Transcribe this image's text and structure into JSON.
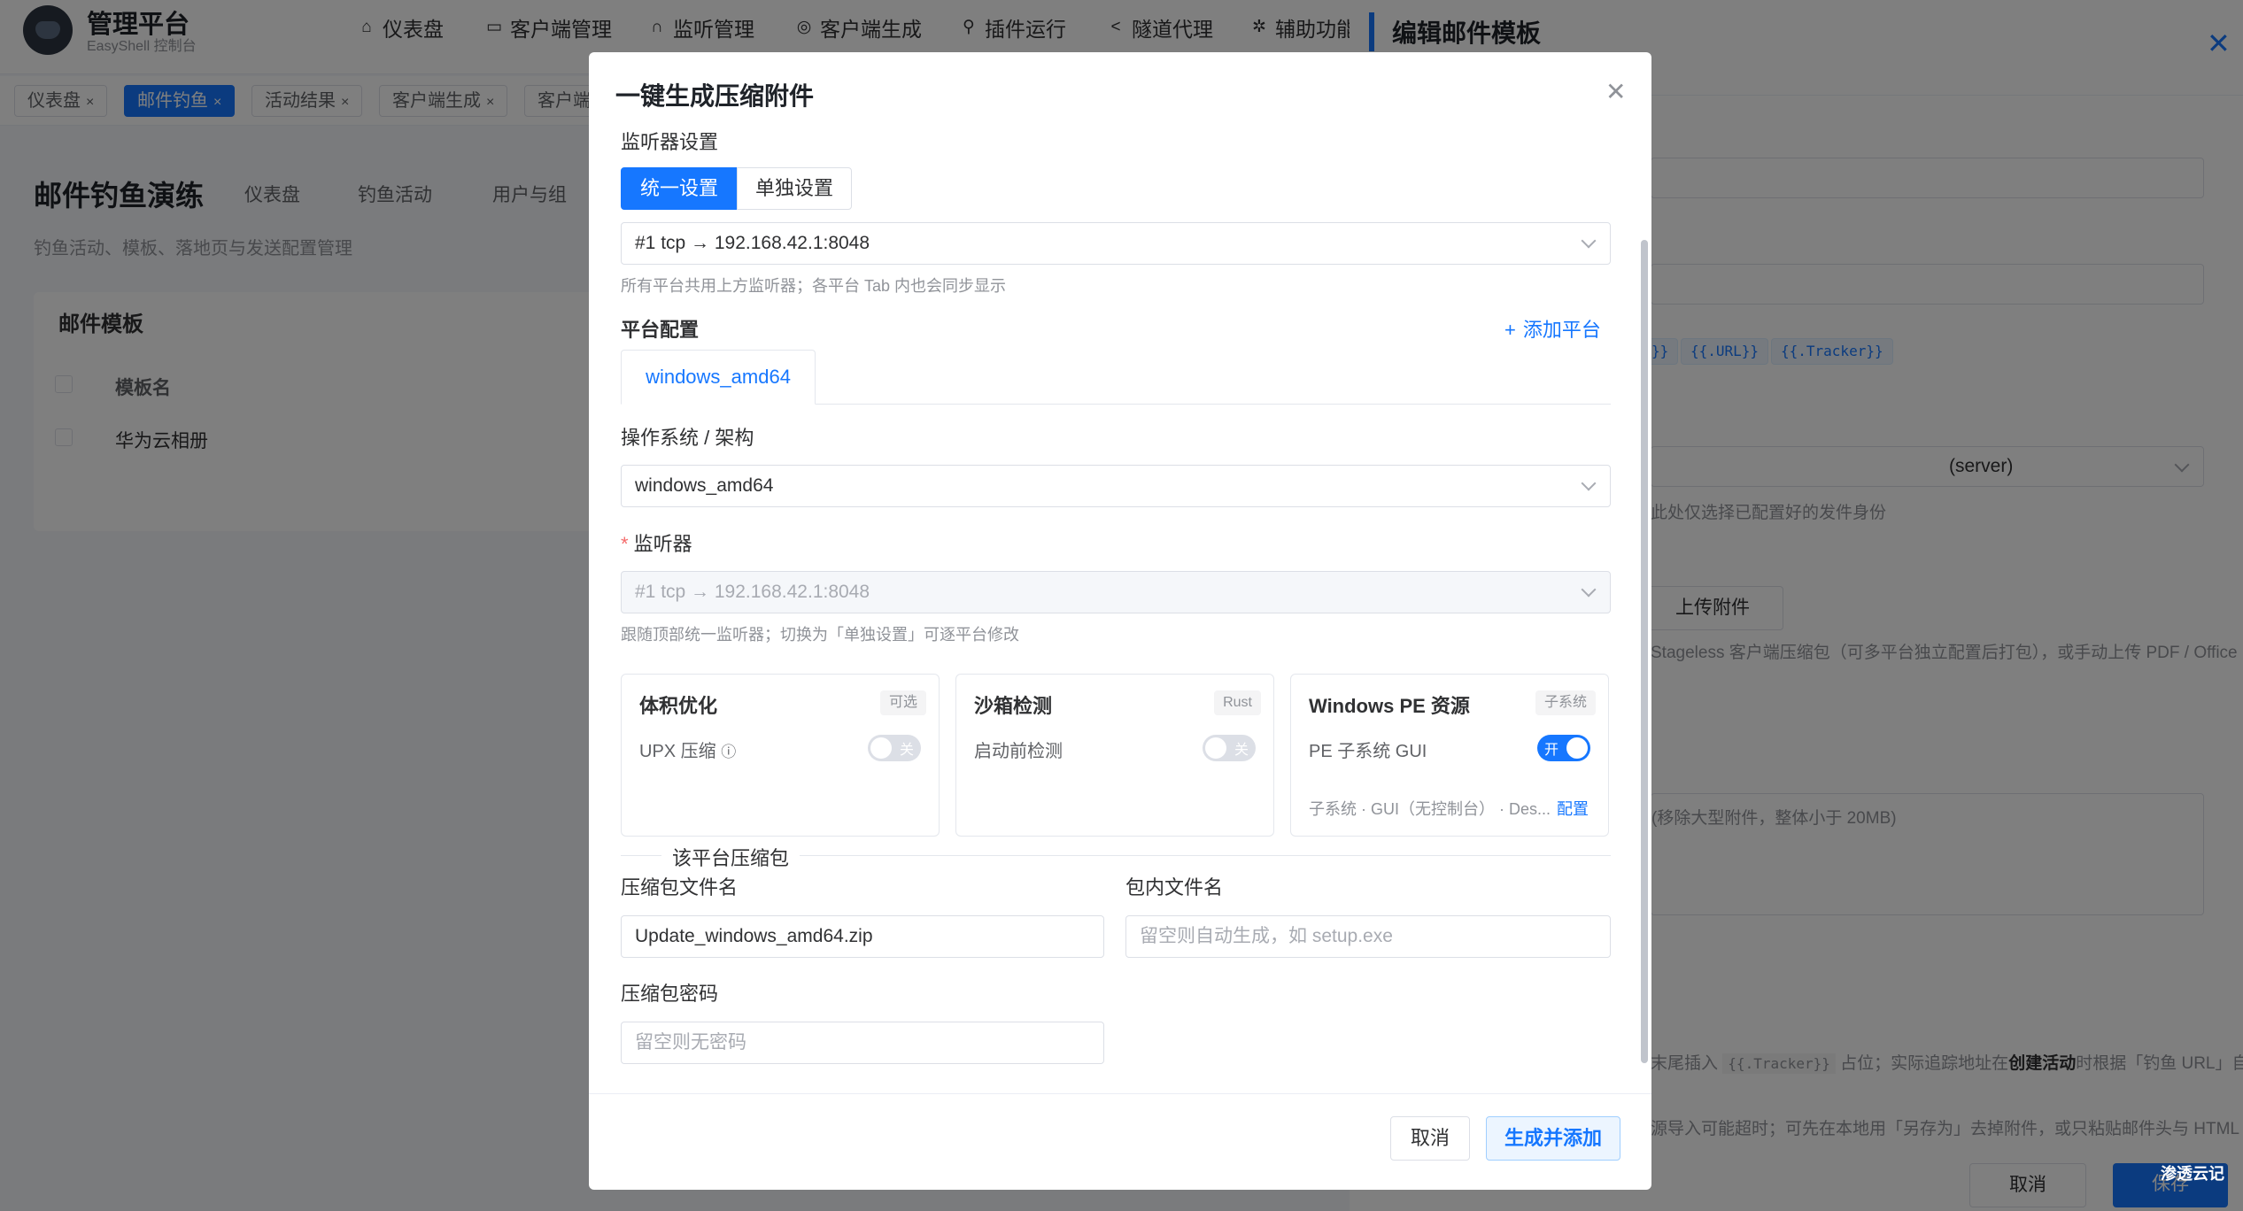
{
  "app": {
    "title": "管理平台",
    "subtitle": "EasyShell 控制台",
    "nav": [
      {
        "label": "仪表盘",
        "icon": "home-icon"
      },
      {
        "label": "客户端管理",
        "icon": "monitor-icon"
      },
      {
        "label": "监听管理",
        "icon": "headset-icon"
      },
      {
        "label": "客户端生成",
        "icon": "package-icon"
      },
      {
        "label": "插件运行",
        "icon": "plugin-icon"
      },
      {
        "label": "隧道代理",
        "icon": "share-icon"
      },
      {
        "label": "辅助功能",
        "icon": "gear-icon"
      }
    ],
    "tags": [
      {
        "label": "仪表盘",
        "active": false
      },
      {
        "label": "邮件钓鱼",
        "active": true
      },
      {
        "label": "活动结果",
        "active": false
      },
      {
        "label": "客户端生成",
        "active": false
      },
      {
        "label": "客户端",
        "active": false
      }
    ]
  },
  "page": {
    "title": "邮件钓鱼演练",
    "sub_tabs": [
      "仪表盘",
      "钓鱼活动",
      "用户与组"
    ],
    "desc": "钓鱼活动、模板、落地页与发送配置管理",
    "card_title": "邮件模板",
    "table_header": "模板名",
    "rows": [
      "华为云相册"
    ]
  },
  "drawer": {
    "title": "编辑邮件模板",
    "chips": [
      "}}",
      "{{.URL}}",
      "{{.Tracker}}"
    ],
    "sender_value": "(server)",
    "sender_hint": "此处仅选择已配置好的发件身份",
    "upload_label": "上传附件",
    "upload_hint": "Stageless 客户端压缩包（可多平台独立配置后打包），或手动上传 PDF / Office",
    "body_placeholder": "(移除大型附件，整体小于 20MB)",
    "footer_hint1_pre": "末尾插入",
    "footer_hint1_chip": "{{.Tracker}}",
    "footer_hint1_mid": "占位；实际追踪地址在",
    "footer_hint1_bold": "创建活动",
    "footer_hint1_post": "时根据「钓鱼 URL」自",
    "footer_hint2": "源导入可能超时；可先在本地用「另存为」去掉附件，或只粘贴邮件头与 HTML",
    "cancel_label": "取消",
    "save_label": "保存"
  },
  "modal": {
    "title": "一键生成压缩附件",
    "listener_section": "监听器设置",
    "segments": [
      "统一设置",
      "单独设置"
    ],
    "active_segment": 0,
    "global_listener": "#1 tcp → 192.168.42.1:8048",
    "global_listener_hint": "所有平台共用上方监听器；各平台 Tab 内也会同步显示",
    "platform_section": "平台配置",
    "add_platform": "添加平台",
    "platform_tab": "windows_amd64",
    "os_arch_label": "操作系统 / 架构",
    "os_arch_value": "windows_amd64",
    "listener_label": "监听器",
    "listener_value": "#1 tcp → 192.168.42.1:8048",
    "listener_hint": "跟随顶部统一监听器；切换为「单独设置」可逐平台修改",
    "features": [
      {
        "title": "体积优化",
        "tag": "可选",
        "label": "UPX 压缩",
        "switch": "关",
        "on": false
      },
      {
        "title": "沙箱检测",
        "tag": "Rust",
        "label": "启动前检测",
        "switch": "关",
        "on": false
      },
      {
        "title": "Windows PE 资源",
        "tag": "子系统",
        "label": "PE 子系统 GUI",
        "switch": "开",
        "on": true,
        "desc": "子系统 · GUI（无控制台） · Des...",
        "link": "配置"
      }
    ],
    "archive_section": "该平台压缩包",
    "archive_name_label": "压缩包文件名",
    "archive_name_value": "Update_windows_amd64.zip",
    "inner_name_label": "包内文件名",
    "inner_name_placeholder": "留空则自动生成，如 setup.exe",
    "password_label": "压缩包密码",
    "password_placeholder": "留空则无密码",
    "cancel_label": "取消",
    "submit_label": "生成并添加"
  },
  "watermark": "渗透云记"
}
